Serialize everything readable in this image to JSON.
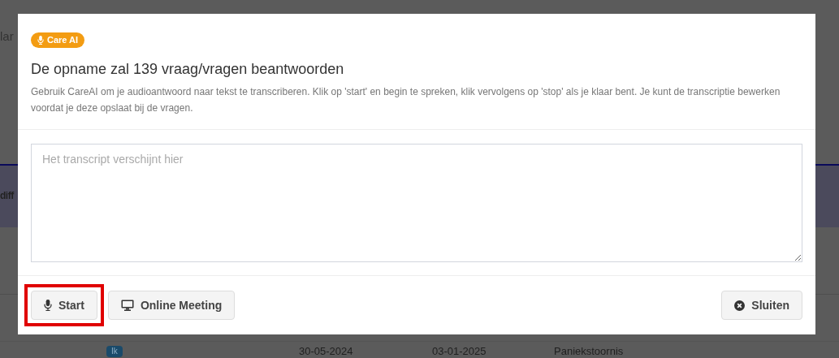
{
  "background": {
    "texts": [
      {
        "kind": "top",
        "text": "lar"
      },
      {
        "kind": "band",
        "text": "diff"
      }
    ],
    "row": {
      "badge": "Ik",
      "cells": [
        "30-05-2024",
        "03-01-2025",
        "Paniekstoornis"
      ]
    }
  },
  "modal": {
    "badge": "Care AI",
    "title": "De opname zal 139 vraag/vragen beantwoorden",
    "description": "Gebruik CareAI om je audioantwoord naar tekst te transcriberen. Klik op 'start' en begin te spreken, klik vervolgens op 'stop' als je klaar bent. Je kunt de transcriptie bewerken voordat je deze opslaat bij de vragen.",
    "transcript": {
      "placeholder": "Het transcript verschijnt hier"
    },
    "buttons": [
      {
        "kind": "mic",
        "label": "Start",
        "highlighted": true
      },
      {
        "kind": "monitor",
        "label": "Online Meeting",
        "highlighted": false
      },
      {
        "kind": "close",
        "label": "Sluiten",
        "highlighted": false
      }
    ]
  }
}
